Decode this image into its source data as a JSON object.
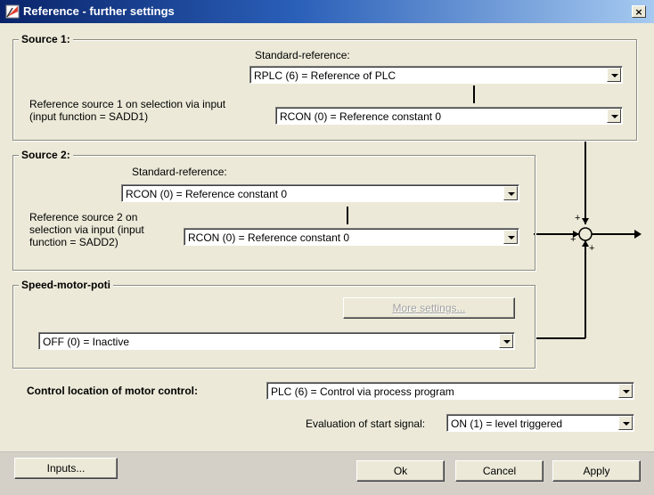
{
  "window": {
    "title": "Reference - further settings",
    "close_glyph": "×"
  },
  "source1": {
    "legend": "Source 1:",
    "standard_label": "Standard-reference:",
    "standard_value": "RPLC (6) = Reference of PLC",
    "selection_label_1": "Reference source 1 on selection via input",
    "selection_label_2": "(input function = SADD1)",
    "selection_value": "RCON (0) = Reference constant 0"
  },
  "source2": {
    "legend": "Source 2:",
    "standard_label": "Standard-reference:",
    "standard_value": "RCON (0) = Reference constant 0",
    "selection_label_1": "Reference source 2 on",
    "selection_label_2": "selection via input (input",
    "selection_label_3": "function = SADD2)",
    "selection_value": "RCON (0) = Reference constant 0"
  },
  "motor_poti": {
    "legend": "Speed-motor-poti",
    "more_settings_label": "More settings...",
    "value": "OFF (0) = Inactive"
  },
  "control": {
    "label": "Control location of motor control:",
    "value": "PLC (6) = Control via process program",
    "start_signal_label": "Evaluation of start signal:",
    "start_signal_value": "ON (1) = level triggered"
  },
  "summing": {
    "sign_top": "+",
    "sign_left": "+",
    "sign_bottom": "+"
  },
  "footer": {
    "inputs_label": "Inputs...",
    "ok_label": "Ok",
    "cancel_label": "Cancel",
    "apply_label": "Apply"
  },
  "icons": {
    "app": "reference-settings-icon",
    "close": "close-icon",
    "dropdown": "chevron-down-icon"
  },
  "colors": {
    "title_start": "#0a246a",
    "title_end": "#a6caf0",
    "dialog_bg": "#ece9d8",
    "app_icon": "#e04030"
  }
}
